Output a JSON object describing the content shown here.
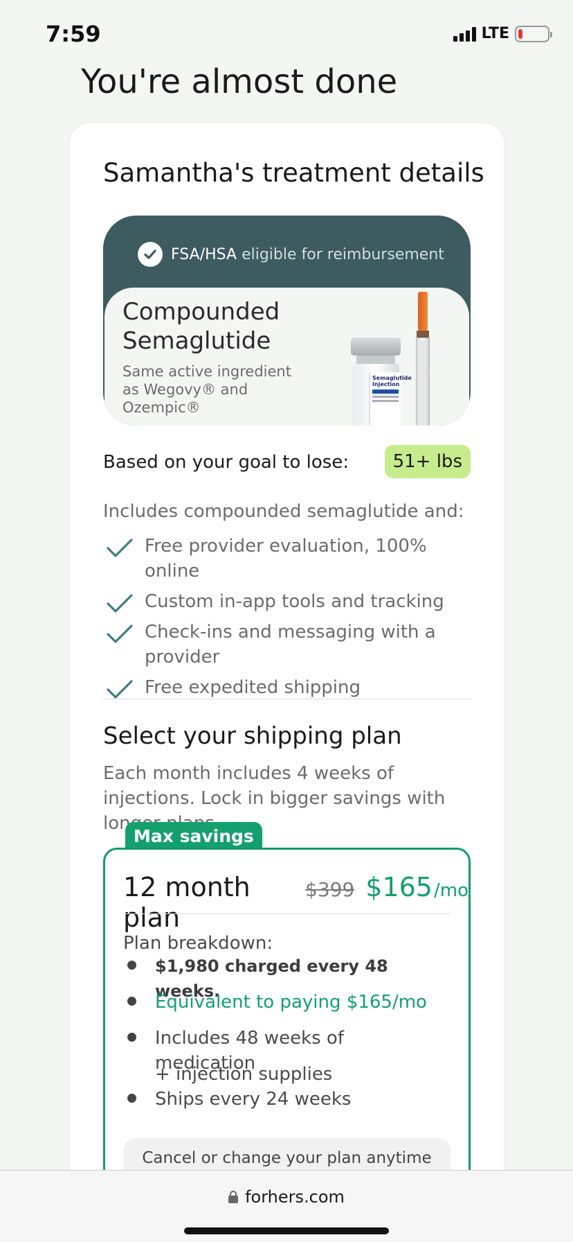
{
  "status_bar": {
    "time": "7:59",
    "network": "LTE",
    "battery_level_fraction": 0.15,
    "battery_color": "#e53935"
  },
  "page": {
    "heading": "You're almost done"
  },
  "card": {
    "title": "Samantha's treatment details",
    "fsa": {
      "strong": "FSA/HSA",
      "light": " eligible for reimbursement",
      "icon": "check-circle-icon"
    },
    "product": {
      "name": "Compounded Semaglutide",
      "subtitle": "Same active ingredient as Wegovy® and Ozempic®",
      "vial_label": "Semaglutide Injection"
    },
    "goal": {
      "label": "Based on your goal to lose:",
      "value": "51+ lbs"
    },
    "includes": {
      "label": "Includes compounded semaglutide and:",
      "items": [
        "Free provider evaluation, 100% online",
        "Custom in-app tools and tracking",
        "Check-ins and messaging with a provider",
        "Free expedited shipping"
      ]
    },
    "shipping": {
      "title": "Select your shipping plan",
      "description": "Each month includes 4 weeks of injections. Lock in bigger savings with longer plans."
    },
    "plan": {
      "tag": "Max savings",
      "name": "12 month plan",
      "old_price": "$399",
      "new_price": "$165",
      "per": "/mo",
      "breakdown_label": "Plan breakdown:",
      "bullets": [
        "$1,980 charged every 48 weeks.",
        "Equivalent to paying $165/mo",
        "Includes 48 weeks of medication",
        "+ injection supplies",
        "Ships every 24 weeks"
      ],
      "cancel_note": "Cancel or change your plan anytime"
    }
  },
  "browser": {
    "url": "forhers.com",
    "icon": "lock-icon"
  },
  "colors": {
    "accent_green": "#13a06e",
    "teal_header": "#3e5b5f",
    "goal_badge": "#c7ec8d",
    "check": "#3e7d80"
  }
}
